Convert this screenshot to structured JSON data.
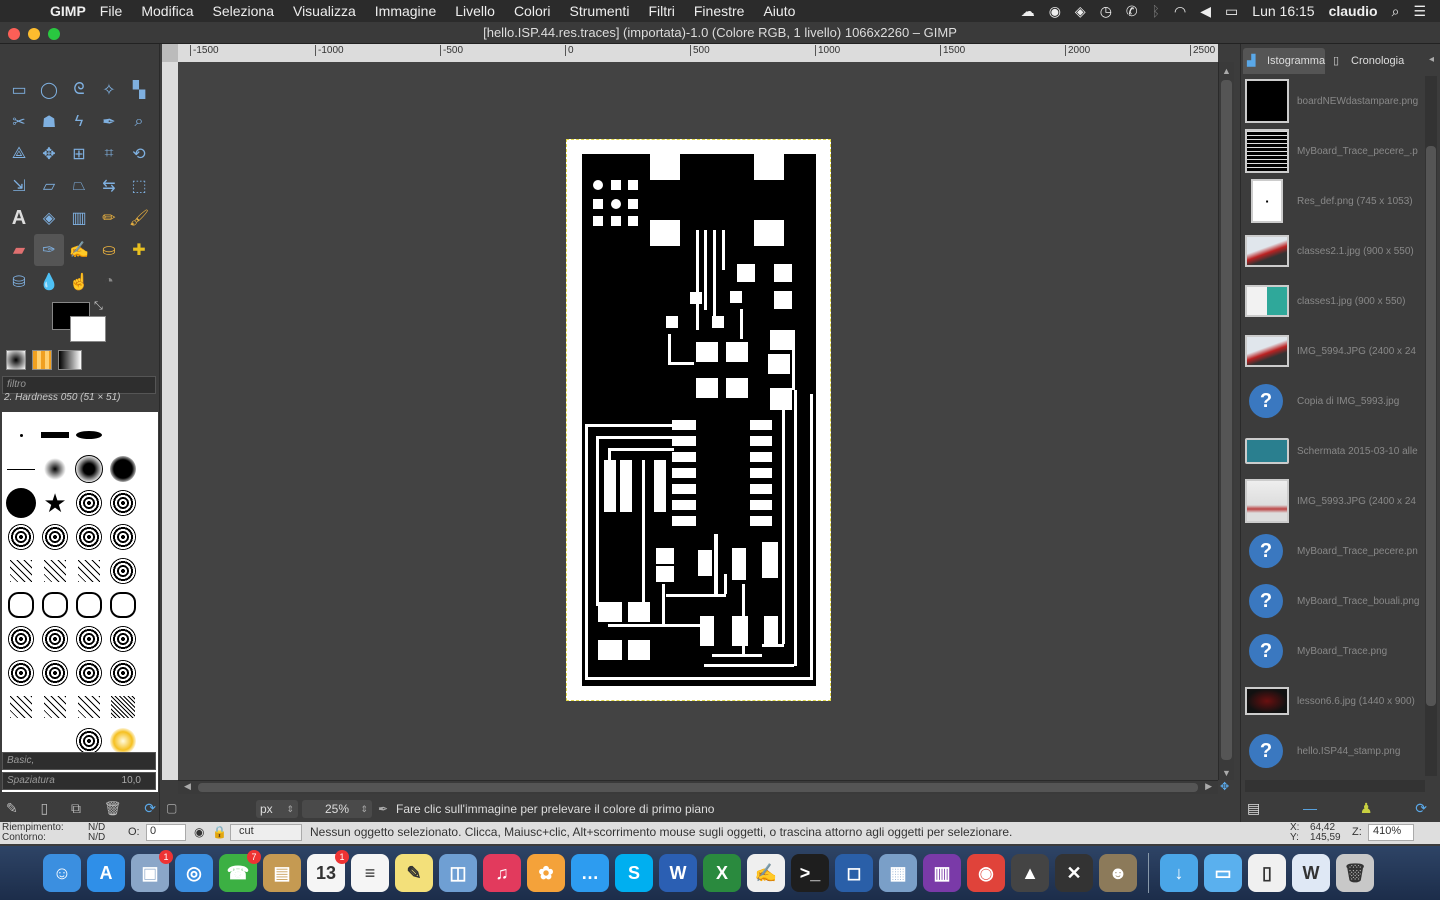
{
  "menubar": {
    "app_name": "GIMP",
    "items": [
      "File",
      "Modifica",
      "Seleziona",
      "Visualizza",
      "Immagine",
      "Livello",
      "Colori",
      "Strumenti",
      "Filtri",
      "Finestre",
      "Aiuto"
    ],
    "clock": "Lun 16:15",
    "user": "claudio"
  },
  "window": {
    "title": "[hello.ISP.44.res.traces] (importata)-1.0 (Colore RGB, 1 livello) 1066x2260 – GIMP"
  },
  "ruler": {
    "h_labels": [
      "-1500",
      "-1000",
      "-500",
      "0",
      "500",
      "1000",
      "1500",
      "2000",
      "2500"
    ]
  },
  "toolbox": {
    "filter_placeholder": "filtro",
    "brush_name": "2. Hardness 050 (51 × 51)",
    "preset": "Basic,",
    "spacing_label": "Spaziatura",
    "spacing_value": "10,0"
  },
  "status": {
    "unit": "px",
    "zoom": "25%",
    "message": "Fare clic sull'immagine per prelevare il colore di primo piano"
  },
  "infobar": {
    "fill_label": "Riempimento:",
    "fill_value": "N/D",
    "stroke_label": "Contorno:",
    "stroke_value": "N/D",
    "o_label": "O:",
    "o_value": "0",
    "layer_select": "cut",
    "message": "Nessun oggetto selezionato. Clicca, Maiusc+clic, Alt+scorrimento mouse sugli oggetti, o trascina attorno agli oggetti per selezionare.",
    "x_label": "X:",
    "x_value": "64,42",
    "y_label": "Y:",
    "y_value": "145,59",
    "z_label": "Z:",
    "z_value": "410%"
  },
  "rightpanel": {
    "tab1": "Istogramma",
    "tab2": "Cronologia",
    "images": [
      {
        "name": "boardNEWdastampare.png",
        "thumb": "black"
      },
      {
        "name": "MyBoard_Trace_pecere_.p",
        "thumb": "board"
      },
      {
        "name": "Res_def.png (745 x 1053)",
        "thumb": "white"
      },
      {
        "name": "classes2.1.jpg (900 x 550)",
        "thumb": "photo-red"
      },
      {
        "name": "classes1.jpg (900 x 550)",
        "thumb": "photo-teal"
      },
      {
        "name": "IMG_5994.JPG (2400 x 24",
        "thumb": "photo-red"
      },
      {
        "name": "Copia di IMG_5993.jpg",
        "thumb": "question"
      },
      {
        "name": "Schermata 2015-03-10 alle",
        "thumb": "screenshot"
      },
      {
        "name": "IMG_5993.JPG (2400 x 24",
        "thumb": "photo-white"
      },
      {
        "name": "MyBoard_Trace_pecere.pn",
        "thumb": "question"
      },
      {
        "name": "MyBoard_Trace_bouali.png",
        "thumb": "question"
      },
      {
        "name": "MyBoard_Trace.png",
        "thumb": "question"
      },
      {
        "name": "lesson6.6.jpg (1440 x 900)",
        "thumb": "dark-red"
      },
      {
        "name": "hello.ISP44_stamp.png",
        "thumb": "question"
      }
    ]
  },
  "dock": {
    "apps": [
      {
        "name": "finder-icon",
        "color": "#3b8fe0",
        "glyph": "☺"
      },
      {
        "name": "app-store-icon",
        "color": "#2f8fe8",
        "glyph": "A"
      },
      {
        "name": "preview-icon",
        "color": "#8aa6c8",
        "glyph": "▣",
        "badge": "1"
      },
      {
        "name": "safari-icon",
        "color": "#3a8ee0",
        "glyph": "◎"
      },
      {
        "name": "facetime-icon",
        "color": "#3cb043",
        "glyph": "☎",
        "badge": "7"
      },
      {
        "name": "contacts-icon",
        "color": "#c59a52",
        "glyph": "▤"
      },
      {
        "name": "calendar-icon",
        "color": "#f5f5f5",
        "glyph": "13",
        "badge": "1"
      },
      {
        "name": "reminders-icon",
        "color": "#f5f5f5",
        "glyph": "≡"
      },
      {
        "name": "notes-icon",
        "color": "#f3e07a",
        "glyph": "✎"
      },
      {
        "name": "preview-doc-icon",
        "color": "#6f9fd3",
        "glyph": "◫"
      },
      {
        "name": "itunes-icon",
        "color": "#e23a5d",
        "glyph": "♫"
      },
      {
        "name": "photos-icon",
        "color": "#f4a23a",
        "glyph": "✿"
      },
      {
        "name": "messages-icon",
        "color": "#2d9cf0",
        "glyph": "…"
      },
      {
        "name": "skype-icon",
        "color": "#00aff0",
        "glyph": "S"
      },
      {
        "name": "word-icon",
        "color": "#2b5fb3",
        "glyph": "W"
      },
      {
        "name": "excel-icon",
        "color": "#2a8a3e",
        "glyph": "X"
      },
      {
        "name": "textedit-icon",
        "color": "#efefef",
        "glyph": "✍"
      },
      {
        "name": "terminal-icon",
        "color": "#1e1e1e",
        "glyph": ">_"
      },
      {
        "name": "sketch-icon",
        "color": "#2a5fa8",
        "glyph": "◻"
      },
      {
        "name": "image-capture-icon",
        "color": "#7a9fc8",
        "glyph": "▦"
      },
      {
        "name": "winrar-icon",
        "color": "#7a3aa8",
        "glyph": "▥"
      },
      {
        "name": "chrome-icon",
        "color": "#e0433a",
        "glyph": "◉"
      },
      {
        "name": "inkscape-icon",
        "color": "#444444",
        "glyph": "▲"
      },
      {
        "name": "xquartz-icon",
        "color": "#333333",
        "glyph": "✕"
      },
      {
        "name": "gimp-icon",
        "color": "#8c7a5a",
        "glyph": "☻"
      },
      {
        "name": "downloads-icon",
        "color": "#4aa6e8",
        "glyph": "↓"
      },
      {
        "name": "folder-icon",
        "color": "#5ab0ee",
        "glyph": "▭"
      },
      {
        "name": "document-icon",
        "color": "#f0f0f0",
        "glyph": "▯"
      },
      {
        "name": "word-doc-icon",
        "color": "#dfe8f5",
        "glyph": "W"
      },
      {
        "name": "trash-icon",
        "color": "#c8c8c8",
        "glyph": "🗑"
      }
    ]
  }
}
